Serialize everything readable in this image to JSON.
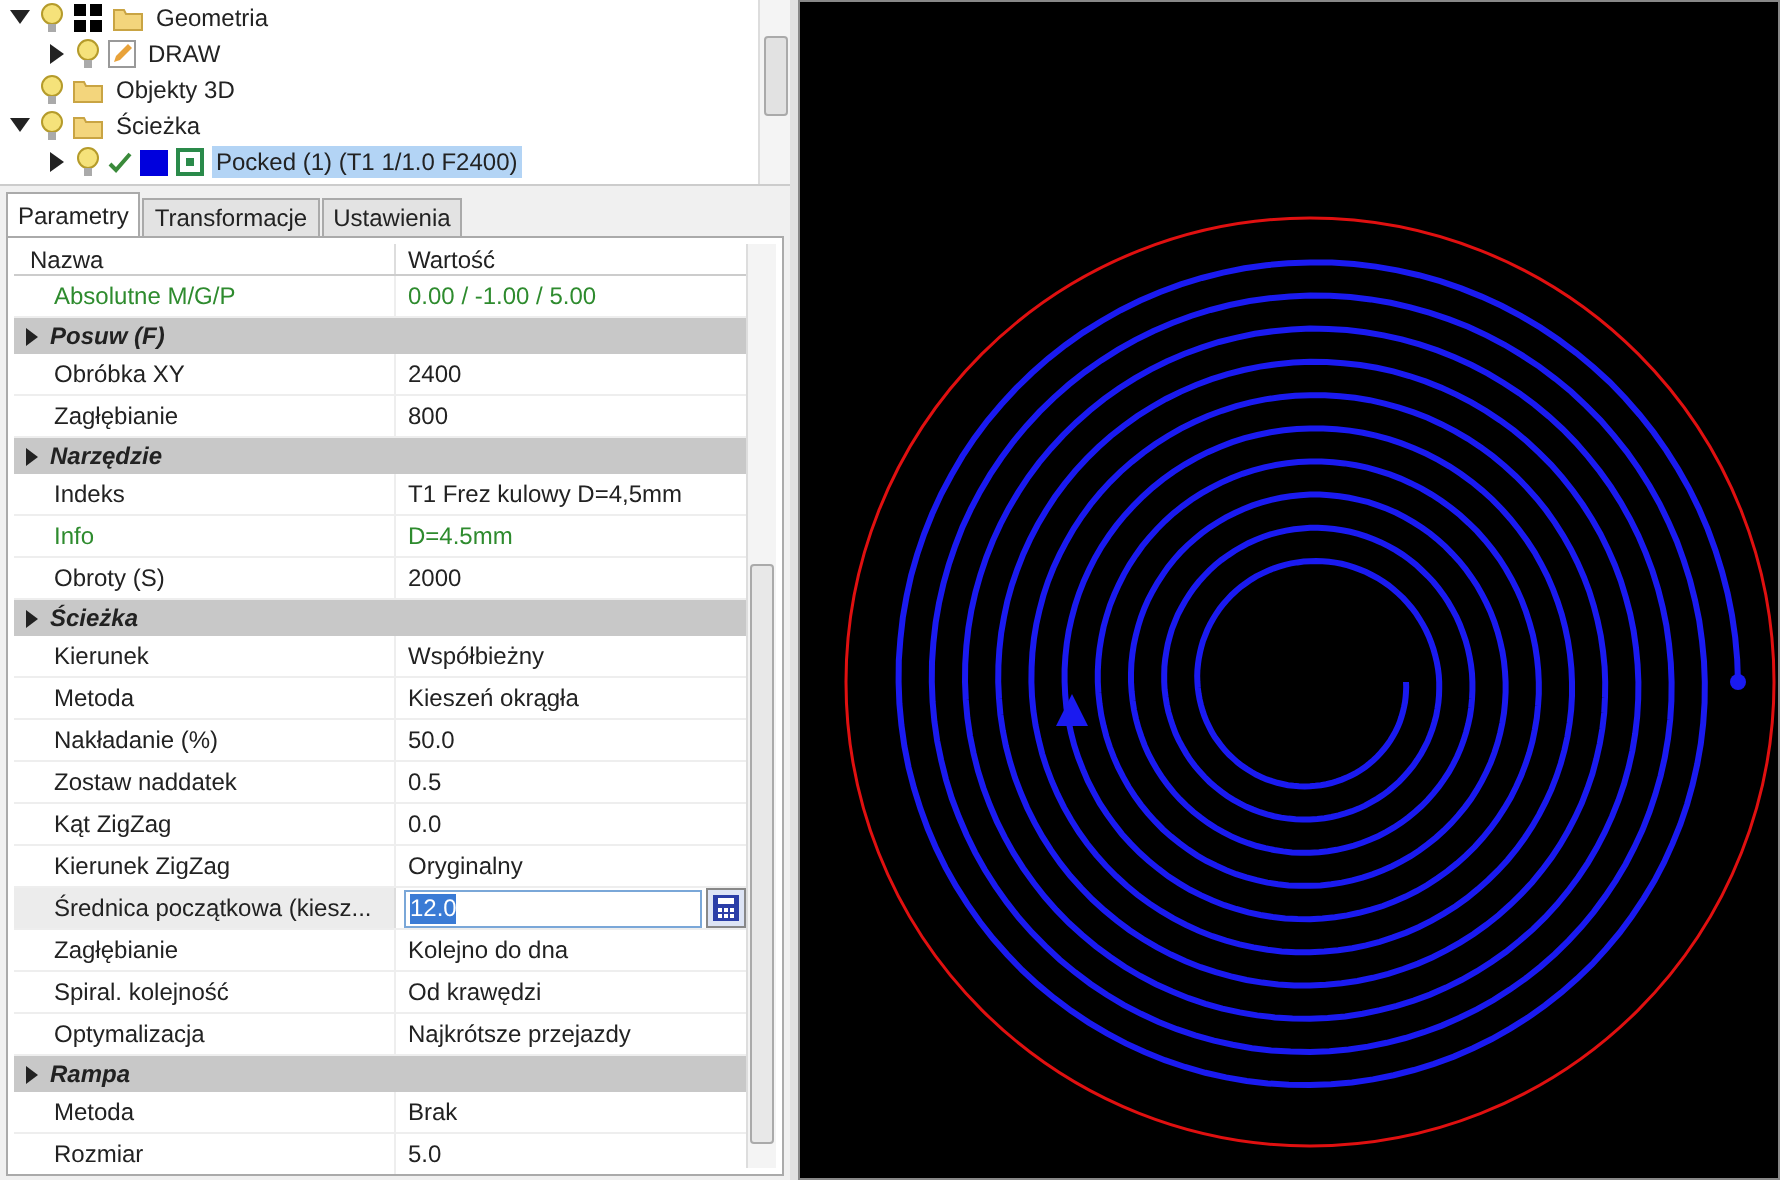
{
  "tree": [
    {
      "label": "Geometria",
      "kind": "group",
      "expanded": true,
      "selected": false,
      "children": [
        {
          "label": "DRAW",
          "kind": "layer",
          "expanded": false,
          "selected": false
        }
      ]
    },
    {
      "label": "Objekty 3D",
      "kind": "folder",
      "selected": false
    },
    {
      "label": "Ścieżka",
      "kind": "folder",
      "expanded": true,
      "selected": false,
      "children": [
        {
          "label": "Pocked (1) (T1 1/1.0 F2400)",
          "kind": "toolpath",
          "expanded": false,
          "selected": true
        }
      ]
    }
  ],
  "tabs": [
    {
      "label": "Parametry",
      "selected": true
    },
    {
      "label": "Transformacje",
      "selected": false
    },
    {
      "label": "Ustawienia",
      "selected": false
    }
  ],
  "grid": {
    "columns": [
      "Nazwa",
      "Wartość"
    ],
    "rows": [
      {
        "kind": "property",
        "name": "Absolutne M/G/P",
        "value": "0.00 / -1.00 / 5.00",
        "color": "#2e8b2e"
      },
      {
        "kind": "section",
        "name": "Posuw (F)"
      },
      {
        "kind": "property",
        "name": "Obróbka XY",
        "value": "2400"
      },
      {
        "kind": "property",
        "name": "Zagłębianie",
        "value": "800"
      },
      {
        "kind": "section",
        "name": "Narzędzie"
      },
      {
        "kind": "property",
        "name": "Indeks",
        "value": "T1 Frez kulowy D=4,5mm"
      },
      {
        "kind": "property",
        "name": "Info",
        "value": "D=4.5mm",
        "color": "#2e8b2e"
      },
      {
        "kind": "property",
        "name": "Obroty (S)",
        "value": "2000"
      },
      {
        "kind": "section",
        "name": "Ścieżka"
      },
      {
        "kind": "property",
        "name": "Kierunek",
        "value": "Współbieżny"
      },
      {
        "kind": "property",
        "name": "Metoda",
        "value": "Kieszeń okrągła"
      },
      {
        "kind": "property",
        "name": "Nakładanie (%)",
        "value": "50.0"
      },
      {
        "kind": "property",
        "name": "Zostaw naddatek",
        "value": "0.5"
      },
      {
        "kind": "property",
        "name": "Kąt ZigZag",
        "value": "0.0"
      },
      {
        "kind": "property",
        "name": "Kierunek ZigZag",
        "value": "Oryginalny"
      },
      {
        "kind": "editing",
        "name": "Średnica początkowa (kiesz...",
        "value": "12.0"
      },
      {
        "kind": "property",
        "name": "Zagłębianie",
        "value": "Kolejno do dna"
      },
      {
        "kind": "property",
        "name": "Spiral. kolejność",
        "value": "Od krawędzi"
      },
      {
        "kind": "property",
        "name": "Optymalizacja",
        "value": "Najkrótsze przejazdy"
      },
      {
        "kind": "section",
        "name": "Rampa"
      },
      {
        "kind": "property",
        "name": "Metoda",
        "value": "Brak"
      },
      {
        "kind": "property",
        "name": "Rozmiar",
        "value": "5.0"
      }
    ]
  }
}
